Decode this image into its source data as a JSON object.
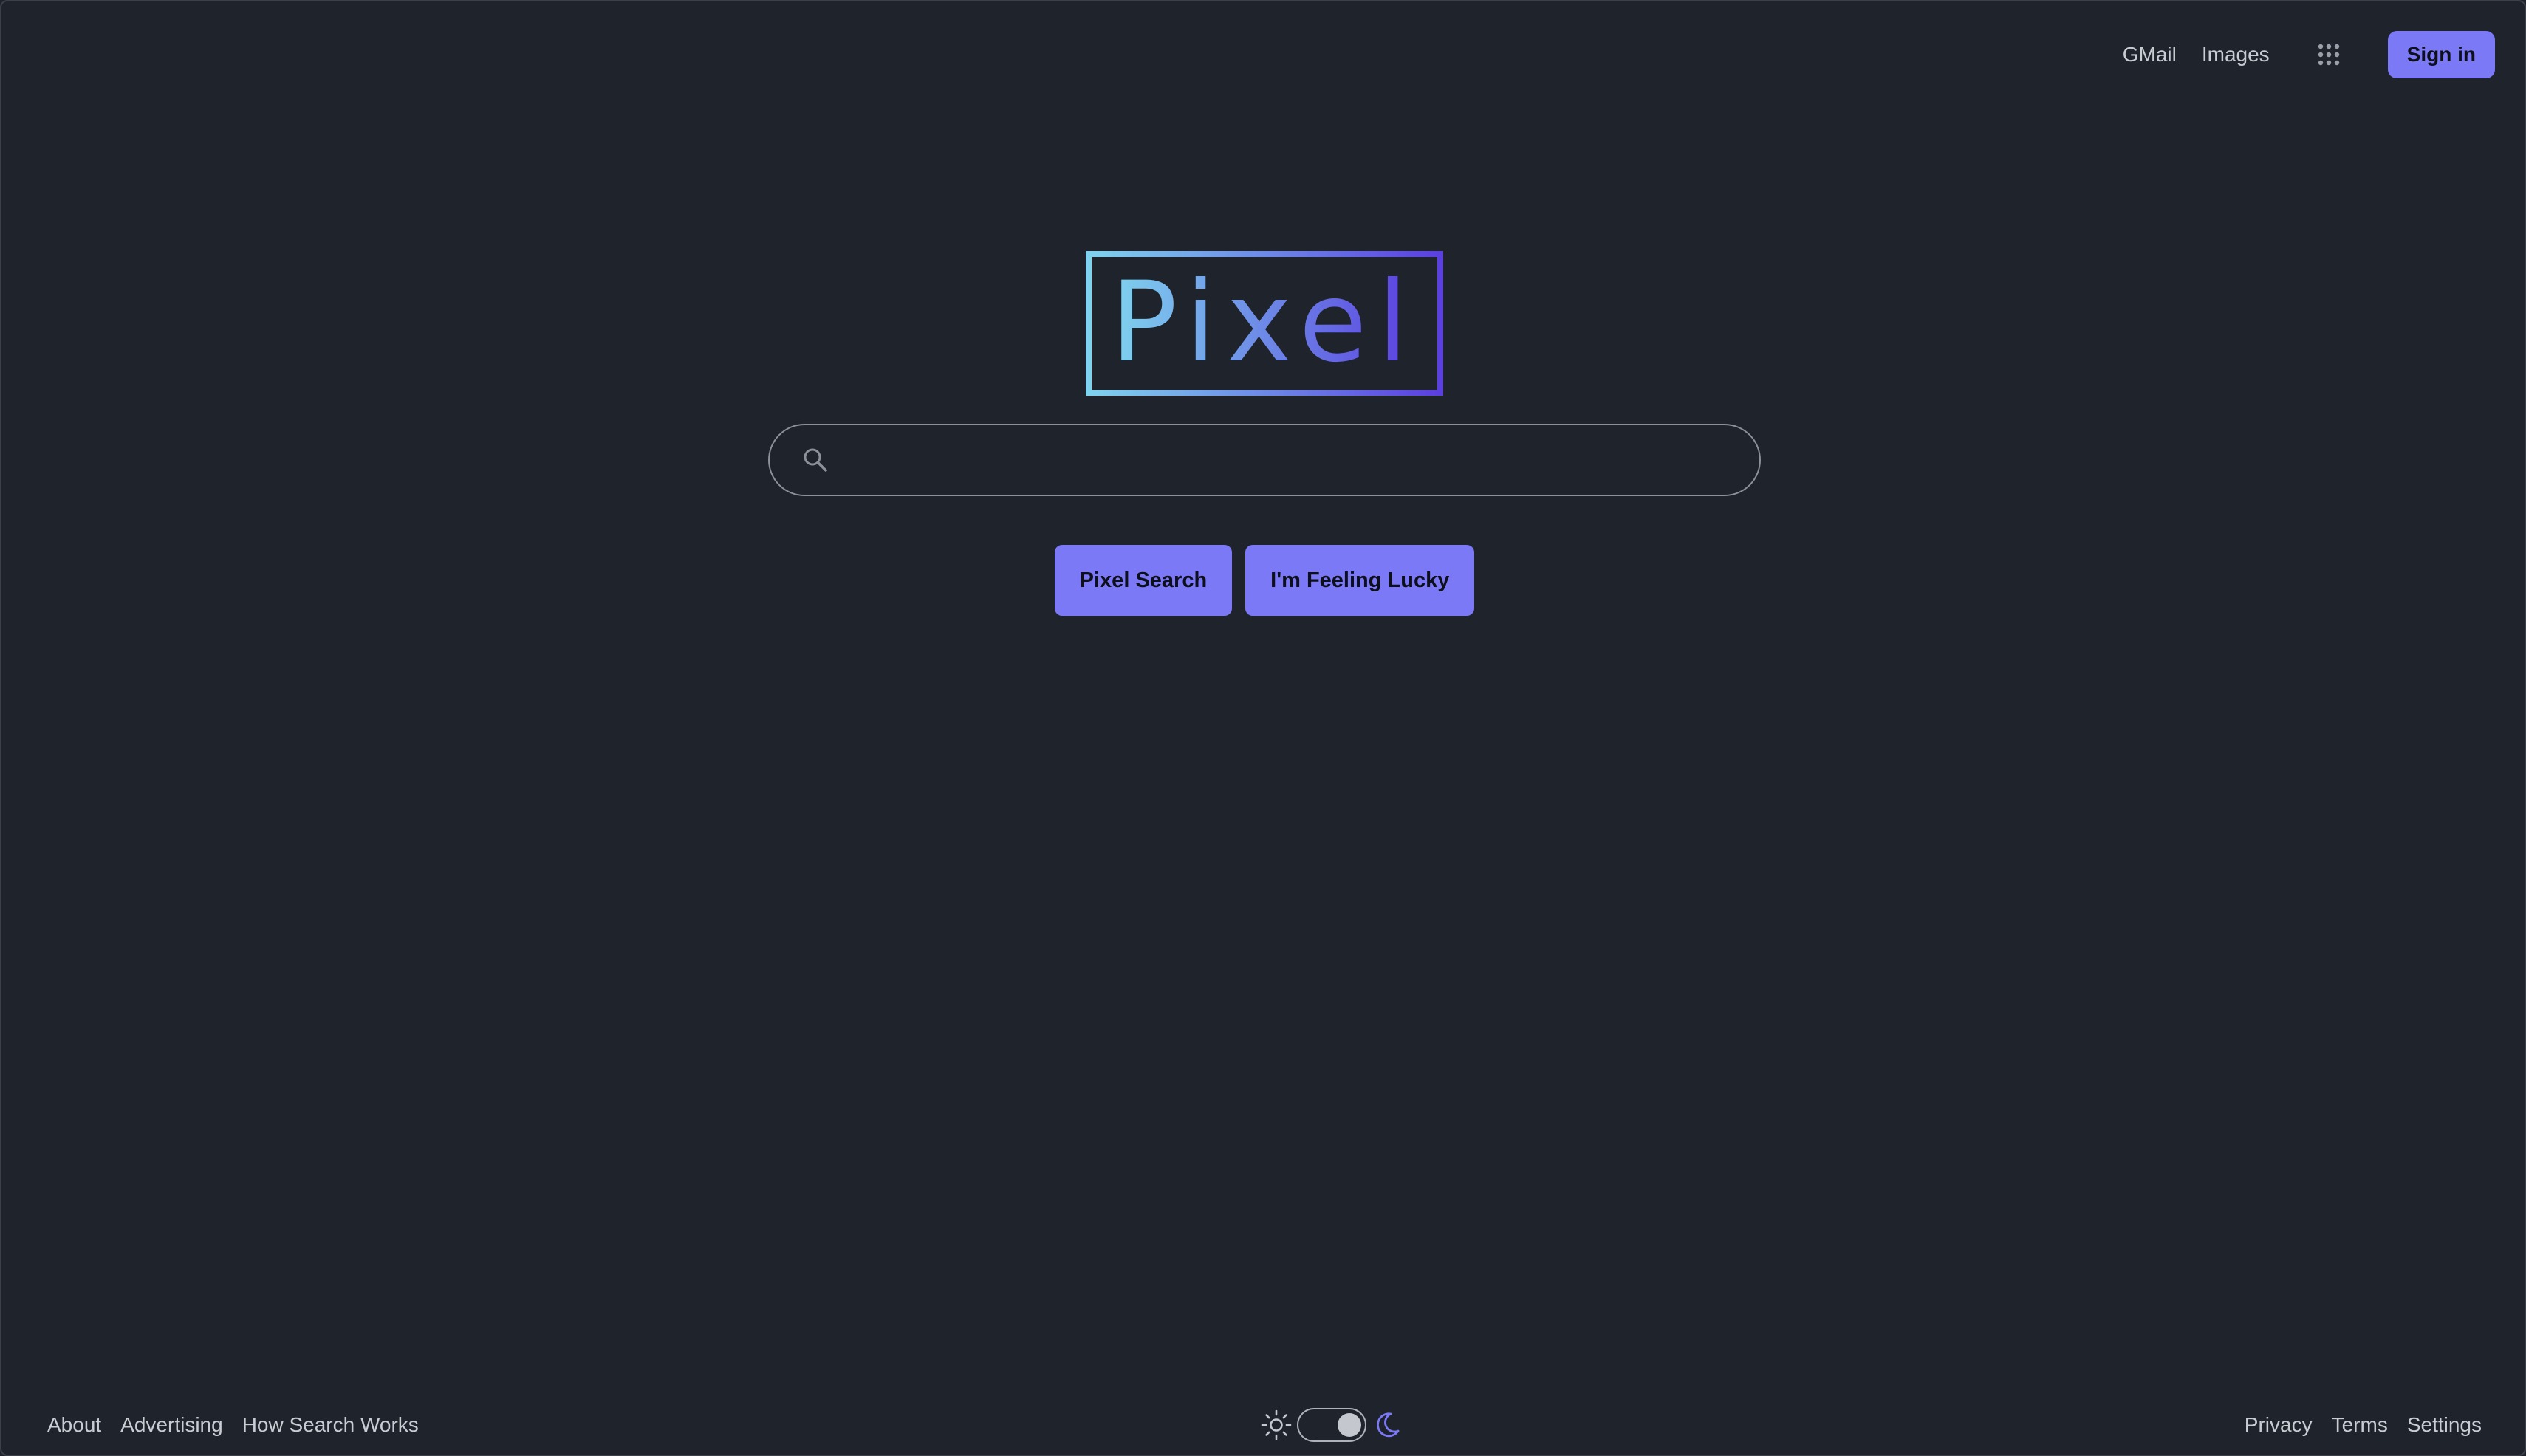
{
  "header": {
    "links": [
      "GMail",
      "Images"
    ],
    "apps_icon": "grid-dots-icon",
    "signin_label": "Sign in"
  },
  "logo": {
    "text": "Pixel",
    "gradient_start": "#7fd3ee",
    "gradient_end": "#5b3fe0"
  },
  "search": {
    "icon": "search-icon",
    "value": "",
    "placeholder": ""
  },
  "actions": {
    "search_label": "Pixel Search",
    "lucky_label": "I'm Feeling Lucky"
  },
  "footer": {
    "left_links": [
      "About",
      "Advertising",
      "How Search Works"
    ],
    "right_links": [
      "Privacy",
      "Terms",
      "Settings"
    ],
    "theme": {
      "light_icon": "sun-icon",
      "dark_icon": "moon-icon",
      "mode": "dark"
    }
  },
  "colors": {
    "background": "#1f232b",
    "accent": "#7b79f6",
    "text": "#c9ccd2"
  }
}
